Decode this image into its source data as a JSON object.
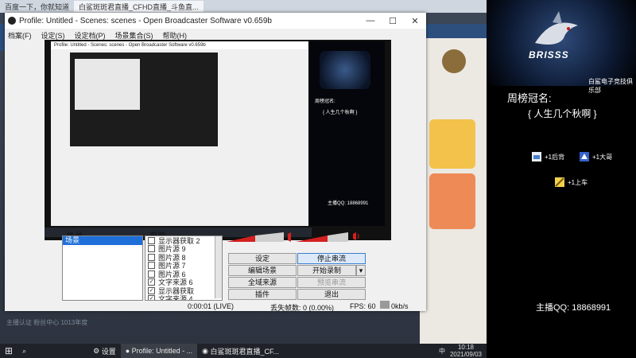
{
  "browser": {
    "tabs": [
      "百度一下，你就知道",
      "白鲨斑斑君直播_CFHD直播_斗鱼直..."
    ]
  },
  "background_page": {
    "text": "主播认证 粉丝中心 1013年度"
  },
  "obs": {
    "title": "Profile: Untitled - Scenes: scenes - Open Broadcaster Software v0.659b",
    "window_controls": [
      "—",
      "☐",
      "✕"
    ],
    "menu": [
      "档案(F)",
      "设定(S)",
      "设定档(P)",
      "场景集合(S)",
      "帮助(H)"
    ],
    "scenes_label": "场景:",
    "scenes": [
      "场景"
    ],
    "sources_label": "来源:",
    "sources": [
      {
        "label": "显示器获取 2",
        "checked": false
      },
      {
        "label": "图片源 9",
        "checked": false
      },
      {
        "label": "图片源 8",
        "checked": false
      },
      {
        "label": "图片源 7",
        "checked": false
      },
      {
        "label": "图片源 6",
        "checked": false
      },
      {
        "label": "文字来源 6",
        "checked": true
      },
      {
        "label": "显示器获取",
        "checked": true
      },
      {
        "label": "文字来源 4",
        "checked": true
      }
    ],
    "buttons": {
      "settings": "设定",
      "stop_stream": "停止串流",
      "edit_scene": "编辑场景",
      "start_record": "开始录制",
      "global_sources": "全域来源",
      "test_stream": "预览串流",
      "plugins": "插件",
      "exit": "退出"
    },
    "status": {
      "time": "0:00:01 (LIVE)",
      "dropped": "丢失帧数: 0 (0.00%)",
      "fps": "FPS: 60",
      "bitrate": "0kb/s"
    },
    "preview": {
      "inner_title": "Profile: Untitled - Scenes: scenes - Open Broadcaster Software v0.659b",
      "side_title": "周榜冠名:",
      "side_name": "{ 人生几个秋啊 }",
      "side_qq": "主播QQ: 18868991"
    }
  },
  "streamer_panel": {
    "logo_text": "BRISSS",
    "logo_sub": "白鲨电子竞技俱乐部",
    "title": "周榜冠名:",
    "name": "{  人生几个秋啊  }",
    "gifts": [
      {
        "label": "+1后背",
        "icon": "gift-box-icon"
      },
      {
        "label": "+1大哥",
        "icon": "gift-card-icon"
      },
      {
        "label": "+1上车",
        "icon": "gift-car-icon"
      }
    ],
    "qq": "主播QQ:  18868991"
  },
  "taskbar": {
    "start": "⊞",
    "search": "⌕",
    "items": [
      "设置",
      "Profile: Untitled - ...",
      "白鲨斑斑君直播_CF..."
    ],
    "lang": "中",
    "time": "10:18",
    "date": "2021/09/03"
  },
  "colors": {
    "accent": "#1e6fd9",
    "meter_red": "#d42020",
    "sidebar_bg": "#000000"
  }
}
